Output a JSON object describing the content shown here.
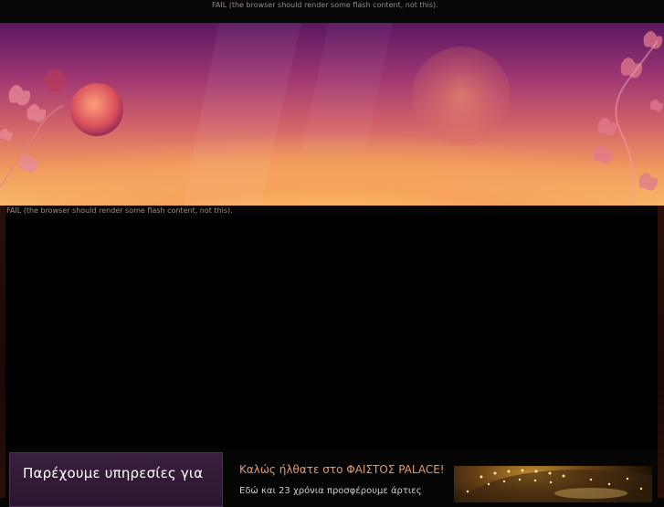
{
  "flash_top": {
    "fail_text": "FAIL (the browser should render some flash content, not this)."
  },
  "flash_main": {
    "fail_text": "FAIL (the browser should render some flash content, not this)."
  },
  "services": {
    "title": "Παρέχουμε υπηρεσίες για"
  },
  "welcome": {
    "title": "Καλώς ήλθατε στο ΦΑΙΣΤΟΣ PALACE!",
    "text": "Εδώ και 23 χρόνια προσφέρουμε άρτιες"
  },
  "colors": {
    "background": "#050505",
    "accent_orange": "#e09a6e",
    "banner_top": "#5a1760",
    "banner_bottom": "#f7c06c",
    "services_box": "#3a1f3e"
  }
}
